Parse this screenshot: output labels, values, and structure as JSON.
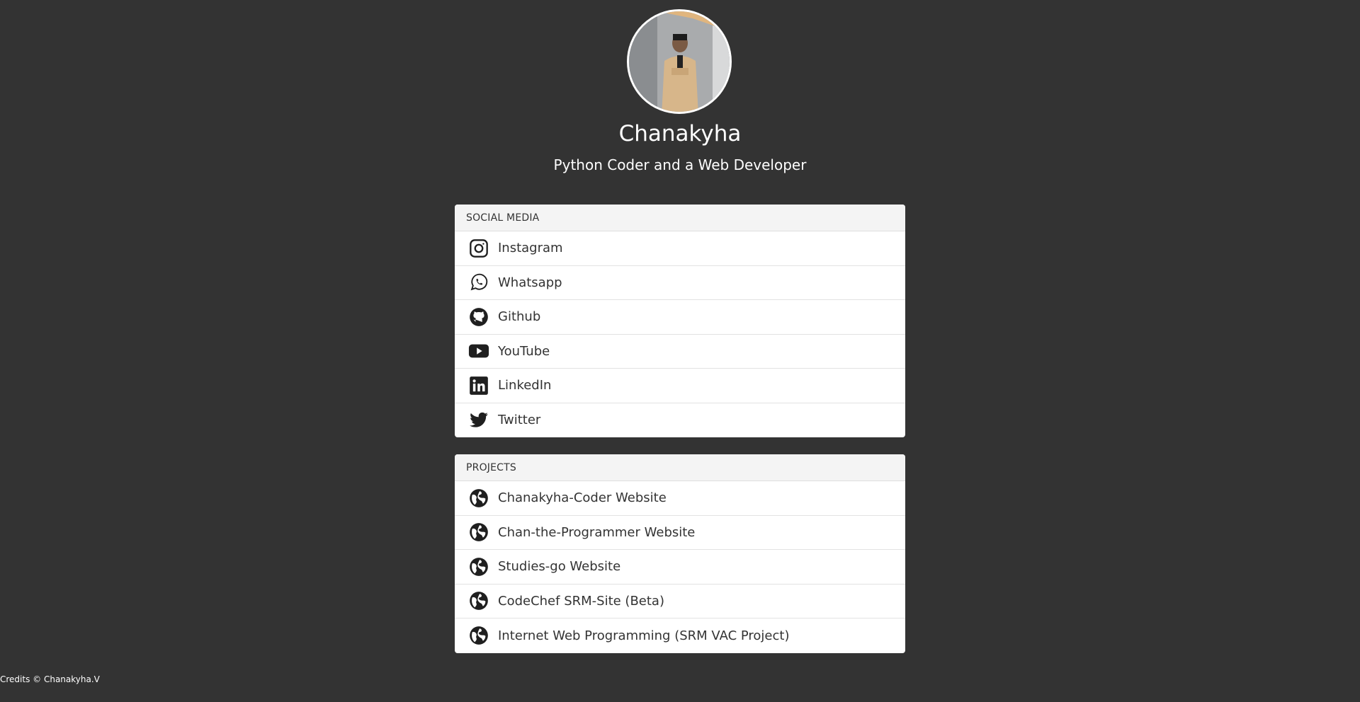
{
  "profile": {
    "name": "Chanakyha",
    "subtitle": "Python Coder and a Web Developer"
  },
  "social": {
    "header": "SOCIAL MEDIA",
    "items": [
      {
        "label": "Instagram",
        "icon": "instagram-icon"
      },
      {
        "label": "Whatsapp",
        "icon": "whatsapp-icon"
      },
      {
        "label": "Github",
        "icon": "github-icon"
      },
      {
        "label": "YouTube",
        "icon": "youtube-icon"
      },
      {
        "label": "LinkedIn",
        "icon": "linkedin-icon"
      },
      {
        "label": "Twitter",
        "icon": "twitter-icon"
      }
    ]
  },
  "projects": {
    "header": "PROJECTS",
    "items": [
      {
        "label": "Chanakyha-Coder Website",
        "icon": "globe-icon"
      },
      {
        "label": "Chan-the-Programmer Website",
        "icon": "globe-icon"
      },
      {
        "label": "Studies-go Website",
        "icon": "globe-icon"
      },
      {
        "label": "CodeChef SRM-Site (Beta)",
        "icon": "globe-icon"
      },
      {
        "label": "Internet Web Programming (SRM VAC Project)",
        "icon": "globe-icon"
      }
    ]
  },
  "footer": {
    "credits": "Credits © Chanakyha.V"
  },
  "colors": {
    "background": "#333333",
    "card": "#ffffff",
    "card_header": "#f4f4f4",
    "text_dark": "#333333"
  }
}
